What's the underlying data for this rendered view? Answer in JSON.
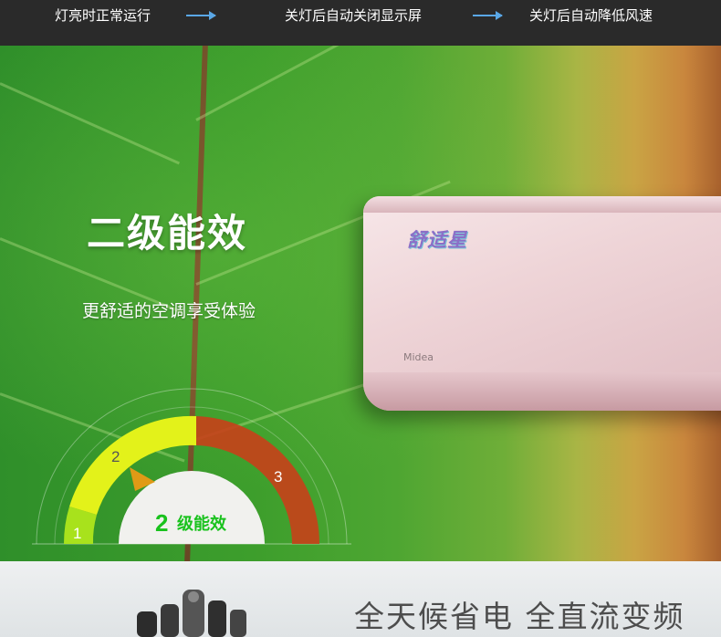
{
  "top_steps": {
    "step1": "灯亮时正常运行",
    "step2": "关灯后自动关闭显示屏",
    "step3": "关灯后自动降低风速"
  },
  "hero": {
    "title": "二级能效",
    "subtitle": "更舒适的空调享受体验"
  },
  "gauge": {
    "levels": [
      "1",
      "2",
      "3"
    ],
    "current_level": 2,
    "current_label_number": "2",
    "current_label_text": "级能效",
    "colors": {
      "level1": "#a8e21c",
      "level2": "#e3f21a",
      "level3": "#c8401a",
      "center": "#f1f1ee",
      "text": "#19c21d"
    }
  },
  "ac_unit": {
    "product_logo": "舒适星",
    "brand": "Midea"
  },
  "bottom": {
    "title": "全天候省电  全直流变频"
  },
  "colors": {
    "topbar": "#2a2a2a",
    "arrow": "#5aa7e6"
  }
}
